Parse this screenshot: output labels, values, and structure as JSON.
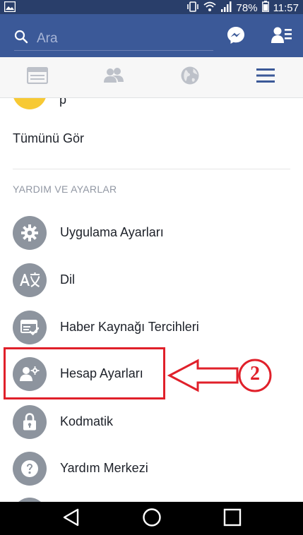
{
  "status_bar": {
    "battery": "78%",
    "time": "11:57"
  },
  "header": {
    "search_placeholder": "Ara"
  },
  "content": {
    "partial_item_label": "...p",
    "see_all": "Tümünü Gör",
    "section_title": "YARDIM VE AYARLAR",
    "menu_items": [
      {
        "label": "Uygulama Ayarları",
        "icon": "gear-icon"
      },
      {
        "label": "Dil",
        "icon": "translate-icon"
      },
      {
        "label": "Haber Kaynağı Tercihleri",
        "icon": "news-feed-preferences-icon"
      },
      {
        "label": "Hesap Ayarları",
        "icon": "account-settings-icon"
      },
      {
        "label": "Kodmatik",
        "icon": "lock-icon"
      },
      {
        "label": "Yardım Merkezi",
        "icon": "help-icon"
      }
    ]
  },
  "annotation": {
    "number": "2",
    "color": "#e0202a"
  },
  "colors": {
    "header_blue": "#3b5998",
    "status_blue": "#293e6a",
    "icon_gray": "#8d949e",
    "accent_tab": "#3b5998"
  }
}
